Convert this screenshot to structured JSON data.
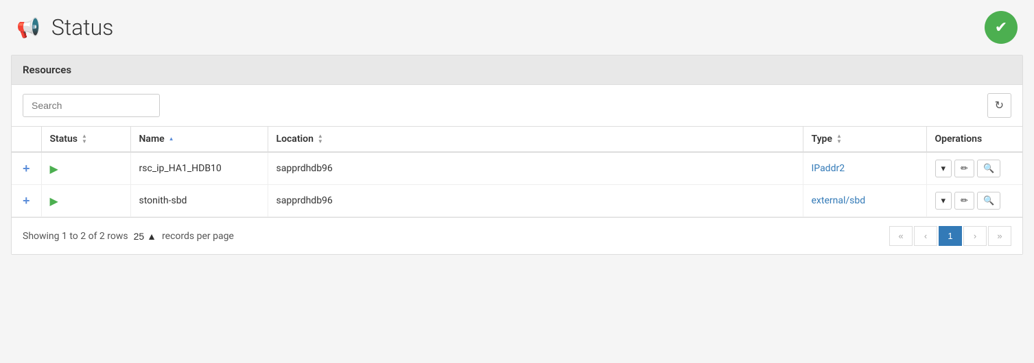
{
  "header": {
    "title": "Status",
    "status_ok": true
  },
  "panel": {
    "title": "Resources"
  },
  "toolbar": {
    "search_placeholder": "Search",
    "refresh_icon": "↻"
  },
  "table": {
    "columns": [
      {
        "id": "checkbox",
        "label": ""
      },
      {
        "id": "status",
        "label": "Status",
        "sortable": true,
        "sort": "none"
      },
      {
        "id": "name",
        "label": "Name",
        "sortable": true,
        "sort": "asc"
      },
      {
        "id": "location",
        "label": "Location",
        "sortable": true,
        "sort": "none"
      },
      {
        "id": "type",
        "label": "Type",
        "sortable": true,
        "sort": "none"
      },
      {
        "id": "operations",
        "label": "Operations",
        "sortable": false
      }
    ],
    "rows": [
      {
        "id": "row1",
        "name": "rsc_ip_HA1_HDB10",
        "location": "sapprdhdb96",
        "type": "IPaddr2",
        "type_link": true,
        "status": "running"
      },
      {
        "id": "row2",
        "name": "stonith-sbd",
        "location": "sapprdhdb96",
        "type": "external/sbd",
        "type_link": true,
        "status": "running"
      }
    ]
  },
  "footer": {
    "showing_text": "Showing 1 to 2 of 2 rows",
    "per_page": "25",
    "per_page_label": "records per page",
    "current_page": 1
  },
  "pagination": {
    "first": "«",
    "prev": "‹",
    "next": "›",
    "last": "»",
    "current": "1"
  },
  "operations": {
    "dropdown_label": "▾",
    "edit_label": "✎",
    "search_label": "🔍"
  }
}
